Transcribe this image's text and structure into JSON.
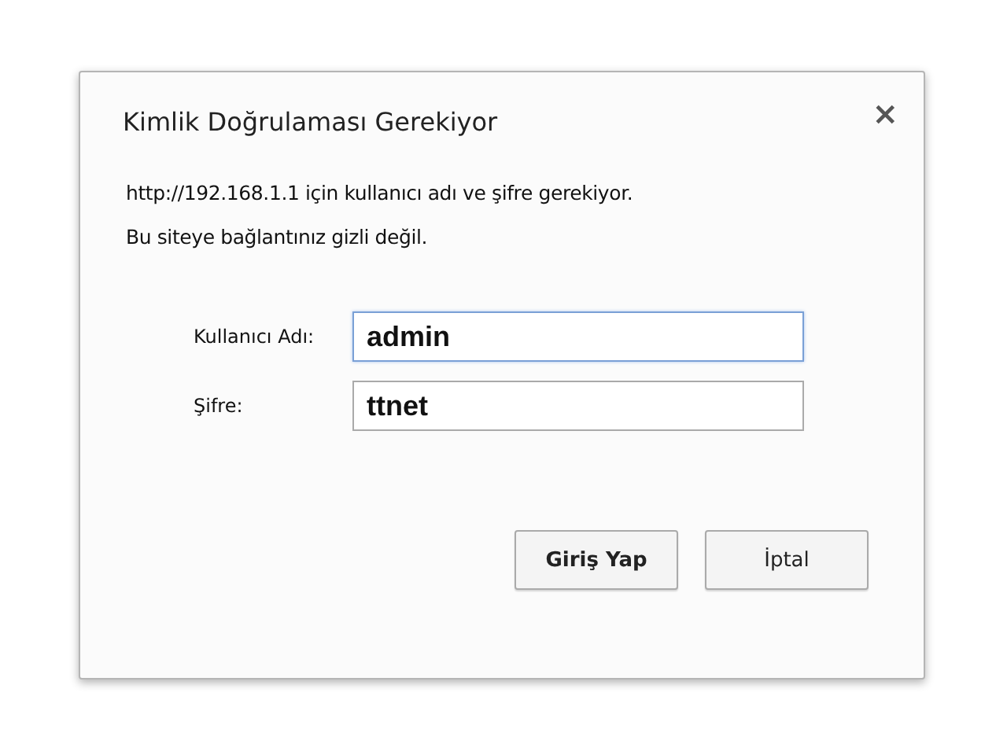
{
  "dialog": {
    "title": "Kimlik Doğrulaması Gerekiyor",
    "close": "×",
    "messages": [
      "http://192.168.1.1 için kullanıcı adı ve şifre gerekiyor.",
      "Bu siteye bağlantınız gizli değil."
    ],
    "fields": [
      {
        "label": "Kullanıcı Adı:",
        "value": "admin",
        "focused": true
      },
      {
        "label": "Şifre:",
        "value": "ttnet",
        "focused": false
      }
    ],
    "buttons": [
      {
        "label": "Giriş Yap",
        "default": true
      },
      {
        "label": "İptal",
        "default": false
      }
    ]
  }
}
